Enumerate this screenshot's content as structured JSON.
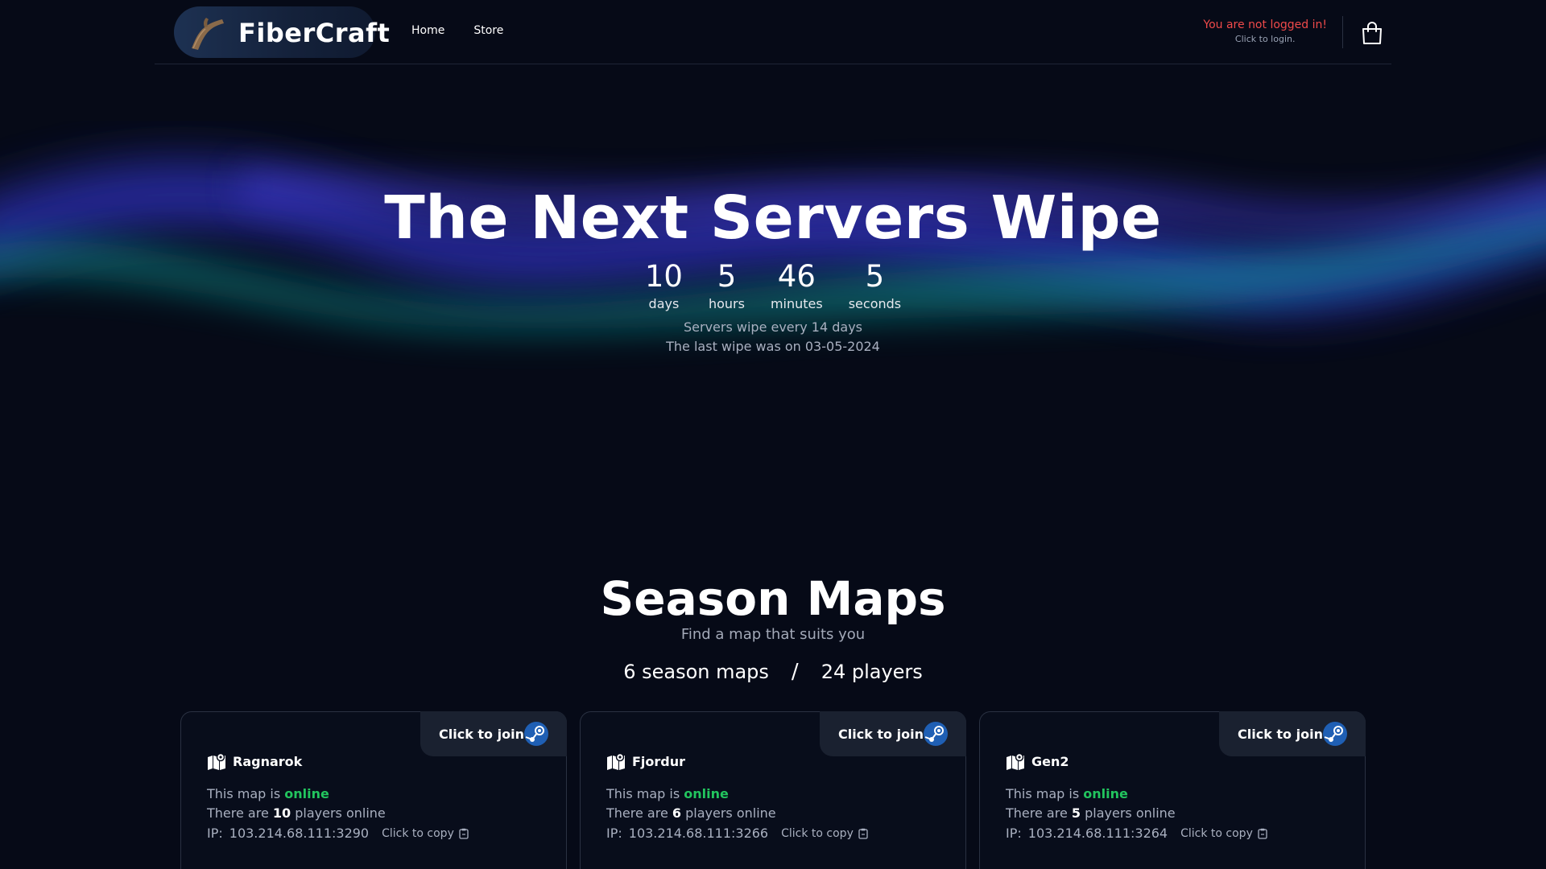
{
  "header": {
    "brand": "FiberCraft",
    "nav": [
      {
        "label": "Home"
      },
      {
        "label": "Store"
      }
    ],
    "login": {
      "title": "You are not logged in!",
      "subtitle": "Click to login."
    },
    "cart_icon": "shopping-bag-icon",
    "logo_icon": "branch-logo-icon"
  },
  "hero": {
    "title": "The Next Servers Wipe",
    "countdown": [
      {
        "value": "10",
        "label": "days"
      },
      {
        "value": "5",
        "label": "hours"
      },
      {
        "value": "46",
        "label": "minutes"
      },
      {
        "value": "5",
        "label": "seconds"
      }
    ],
    "wipe_frequency": "Servers wipe every 14 days",
    "last_wipe": "The last wipe was on 03-05-2024"
  },
  "maps_section": {
    "title": "Season Maps",
    "subtitle": "Find a map that suits you",
    "maps_count": "6 season maps",
    "separator": "/",
    "players_count": "24 players"
  },
  "maps": [
    {
      "name": "Ragnarok",
      "join_label": "Click to join",
      "status_prefix": "This map is",
      "status": "online",
      "players_prefix": "There are",
      "players": "10",
      "players_suffix": "players online",
      "ip_label": "IP:",
      "ip": "103.214.68.111:3290",
      "copy_label": "Click to copy"
    },
    {
      "name": "Fjordur",
      "join_label": "Click to join",
      "status_prefix": "This map is",
      "status": "online",
      "players_prefix": "There are",
      "players": "6",
      "players_suffix": "players online",
      "ip_label": "IP:",
      "ip": "103.214.68.111:3266",
      "copy_label": "Click to copy"
    },
    {
      "name": "Gen2",
      "join_label": "Click to join",
      "status_prefix": "This map is",
      "status": "online",
      "players_prefix": "There are",
      "players": "5",
      "players_suffix": "players online",
      "ip_label": "IP:",
      "ip": "103.214.68.111:3264",
      "copy_label": "Click to copy"
    }
  ],
  "colors": {
    "background": "#060a17",
    "online": "#22c55e",
    "login_warning": "#f04a4a",
    "aurora_blue": "#3b3fd6",
    "aurora_teal": "#14b8a6"
  }
}
